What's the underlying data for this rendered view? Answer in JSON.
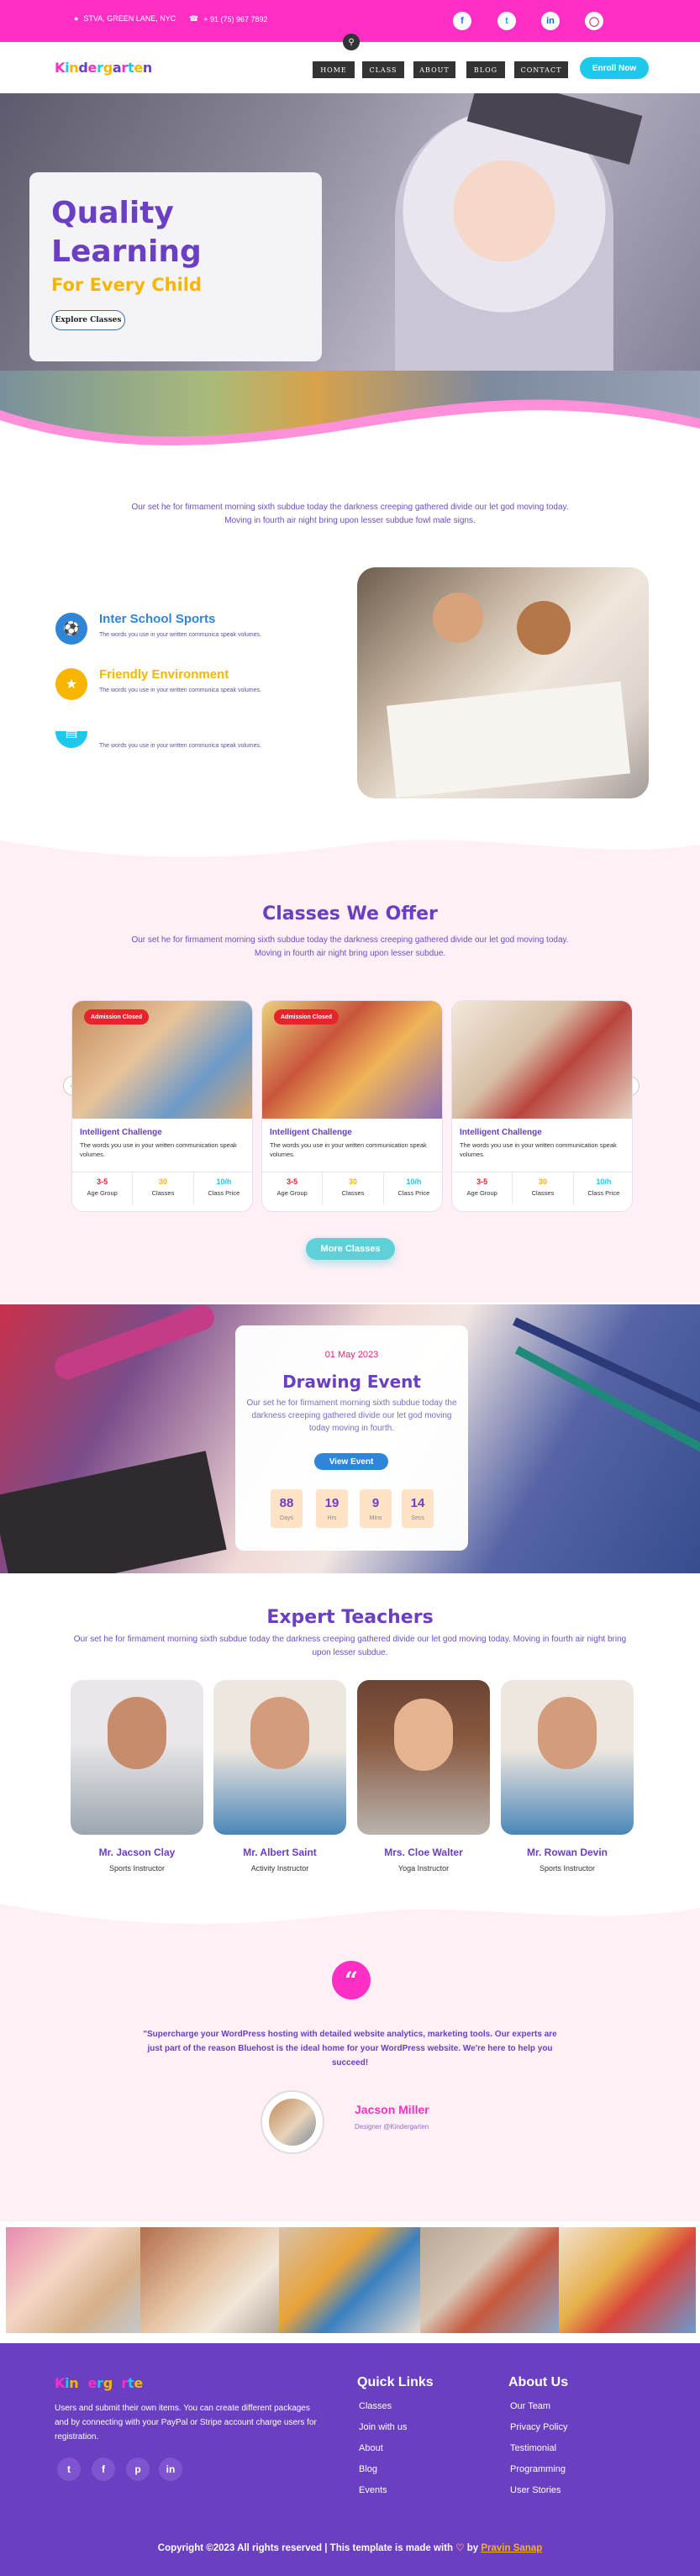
{
  "topbar": {
    "address": "STVA, GREEN LANE, NYC",
    "phone": "+ 91 (75) 967 7892",
    "social": [
      "facebook-icon",
      "twitter-icon",
      "linkedin-icon",
      "instagram-icon"
    ]
  },
  "brand": {
    "letters": [
      "K",
      "i",
      "n",
      "d",
      "e",
      "r",
      "g",
      "a",
      "r",
      "t",
      "e",
      "n"
    ],
    "colors": [
      "#ff2ec4",
      "#1ec8ea",
      "#f7b500",
      "#6a3fc1"
    ]
  },
  "nav": {
    "items": [
      "HOME",
      "CLASS",
      "ABOUT",
      "BLOG",
      "CONTACT"
    ],
    "cta": "Enroll Now"
  },
  "hero": {
    "title_line1": "Quality",
    "title_line2": "Learning",
    "subtitle": "For Every Child",
    "button": "Explore Classes"
  },
  "about": {
    "lead": "Our set he for firmament morning sixth subdue today the darkness creeping gathered divide our let god moving today. Moving in fourth air night bring upon lesser subdue fowl male signs.",
    "features": [
      {
        "title": "Inter School Sports",
        "text": "The words you use in your written communica speak volumes.",
        "color": "#2f86d8"
      },
      {
        "title": "Friendly Environment",
        "text": "The words you use in your written communica speak volumes.",
        "color": "#f7b500"
      },
      {
        "title": "",
        "text": "The words you use in your written communica speak volumes.",
        "color": "#1ec8ea"
      }
    ]
  },
  "classes": {
    "heading": "Classes We Offer",
    "lead": "Our set he for firmament morning sixth subdue today the darkness creeping gathered divide our let god moving today. Moving in fourth air night bring upon lesser subdue.",
    "cards": [
      {
        "tag": "Admission Closed",
        "title": "Intelligent Challenge",
        "text": "The words you use in your written communication speak volumes.",
        "age": "3-5",
        "classes": "30",
        "price": "10/h",
        "age_label": "Age Group",
        "classes_label": "Classes",
        "price_label": "Class Price"
      },
      {
        "tag": "Admission Closed",
        "title": "Intelligent Challenge",
        "text": "The words you use in your written communication speak volumes.",
        "age": "3-5",
        "classes": "30",
        "price": "10/h",
        "age_label": "Age Group",
        "classes_label": "Classes",
        "price_label": "Class Price"
      },
      {
        "tag": "",
        "title": "Intelligent Challenge",
        "text": "The words you use in your written communication speak volumes.",
        "age": "3-5",
        "classes": "30",
        "price": "10/h",
        "age_label": "Age Group",
        "classes_label": "Classes",
        "price_label": "Class Price"
      }
    ],
    "more": "More Classes"
  },
  "event": {
    "date": "01 May 2023",
    "title": "Drawing Event",
    "text": "Our set he for firmament morning sixth subdue today the darkness creeping gathered divide our let god moving today moving in fourth.",
    "button": "View Event",
    "countdown": [
      {
        "value": "88",
        "label": "Days"
      },
      {
        "value": "19",
        "label": "Hrs"
      },
      {
        "value": "9",
        "label": "Mins"
      },
      {
        "value": "14",
        "label": "Secs"
      }
    ]
  },
  "teachers": {
    "heading": "Expert Teachers",
    "lead": "Our set he for firmament morning sixth subdue today the darkness creeping gathered divide our let god moving today. Moving in fourth air night bring upon lesser subdue.",
    "list": [
      {
        "name": "Mr. Jacson Clay",
        "role": "Sports Instructor"
      },
      {
        "name": "Mr. Albert Saint",
        "role": "Activity Instructor"
      },
      {
        "name": "Mrs. Cloe Walter",
        "role": "Yoga Instructor"
      },
      {
        "name": "Mr. Rowan Devin",
        "role": "Sports Instructor"
      }
    ]
  },
  "testimonial": {
    "quote": "\"Supercharge your WordPress hosting with detailed website analytics, marketing tools. Our experts are just part of the reason Bluehost is the ideal home for your WordPress website. We're here to help you succeed!",
    "name": "Jacson Miller",
    "role": "Designer @Kindergarten"
  },
  "footer": {
    "about": "Users and submit their own items. You can create different packages and by connecting with your PayPal or Stripe account charge users for registration.",
    "quick_heading": "Quick Links",
    "quick_links": [
      "Classes",
      "Join with us",
      "About",
      "Blog",
      "Events"
    ],
    "about_heading": "About Us",
    "about_links": [
      "Our Team",
      "Privacy Policy",
      "Testimonial",
      "Programming",
      "User Stories"
    ],
    "copyright": "Copyright ©2023 All rights reserved | This template is made with",
    "by": "by",
    "author": "Pravin Sanap"
  }
}
